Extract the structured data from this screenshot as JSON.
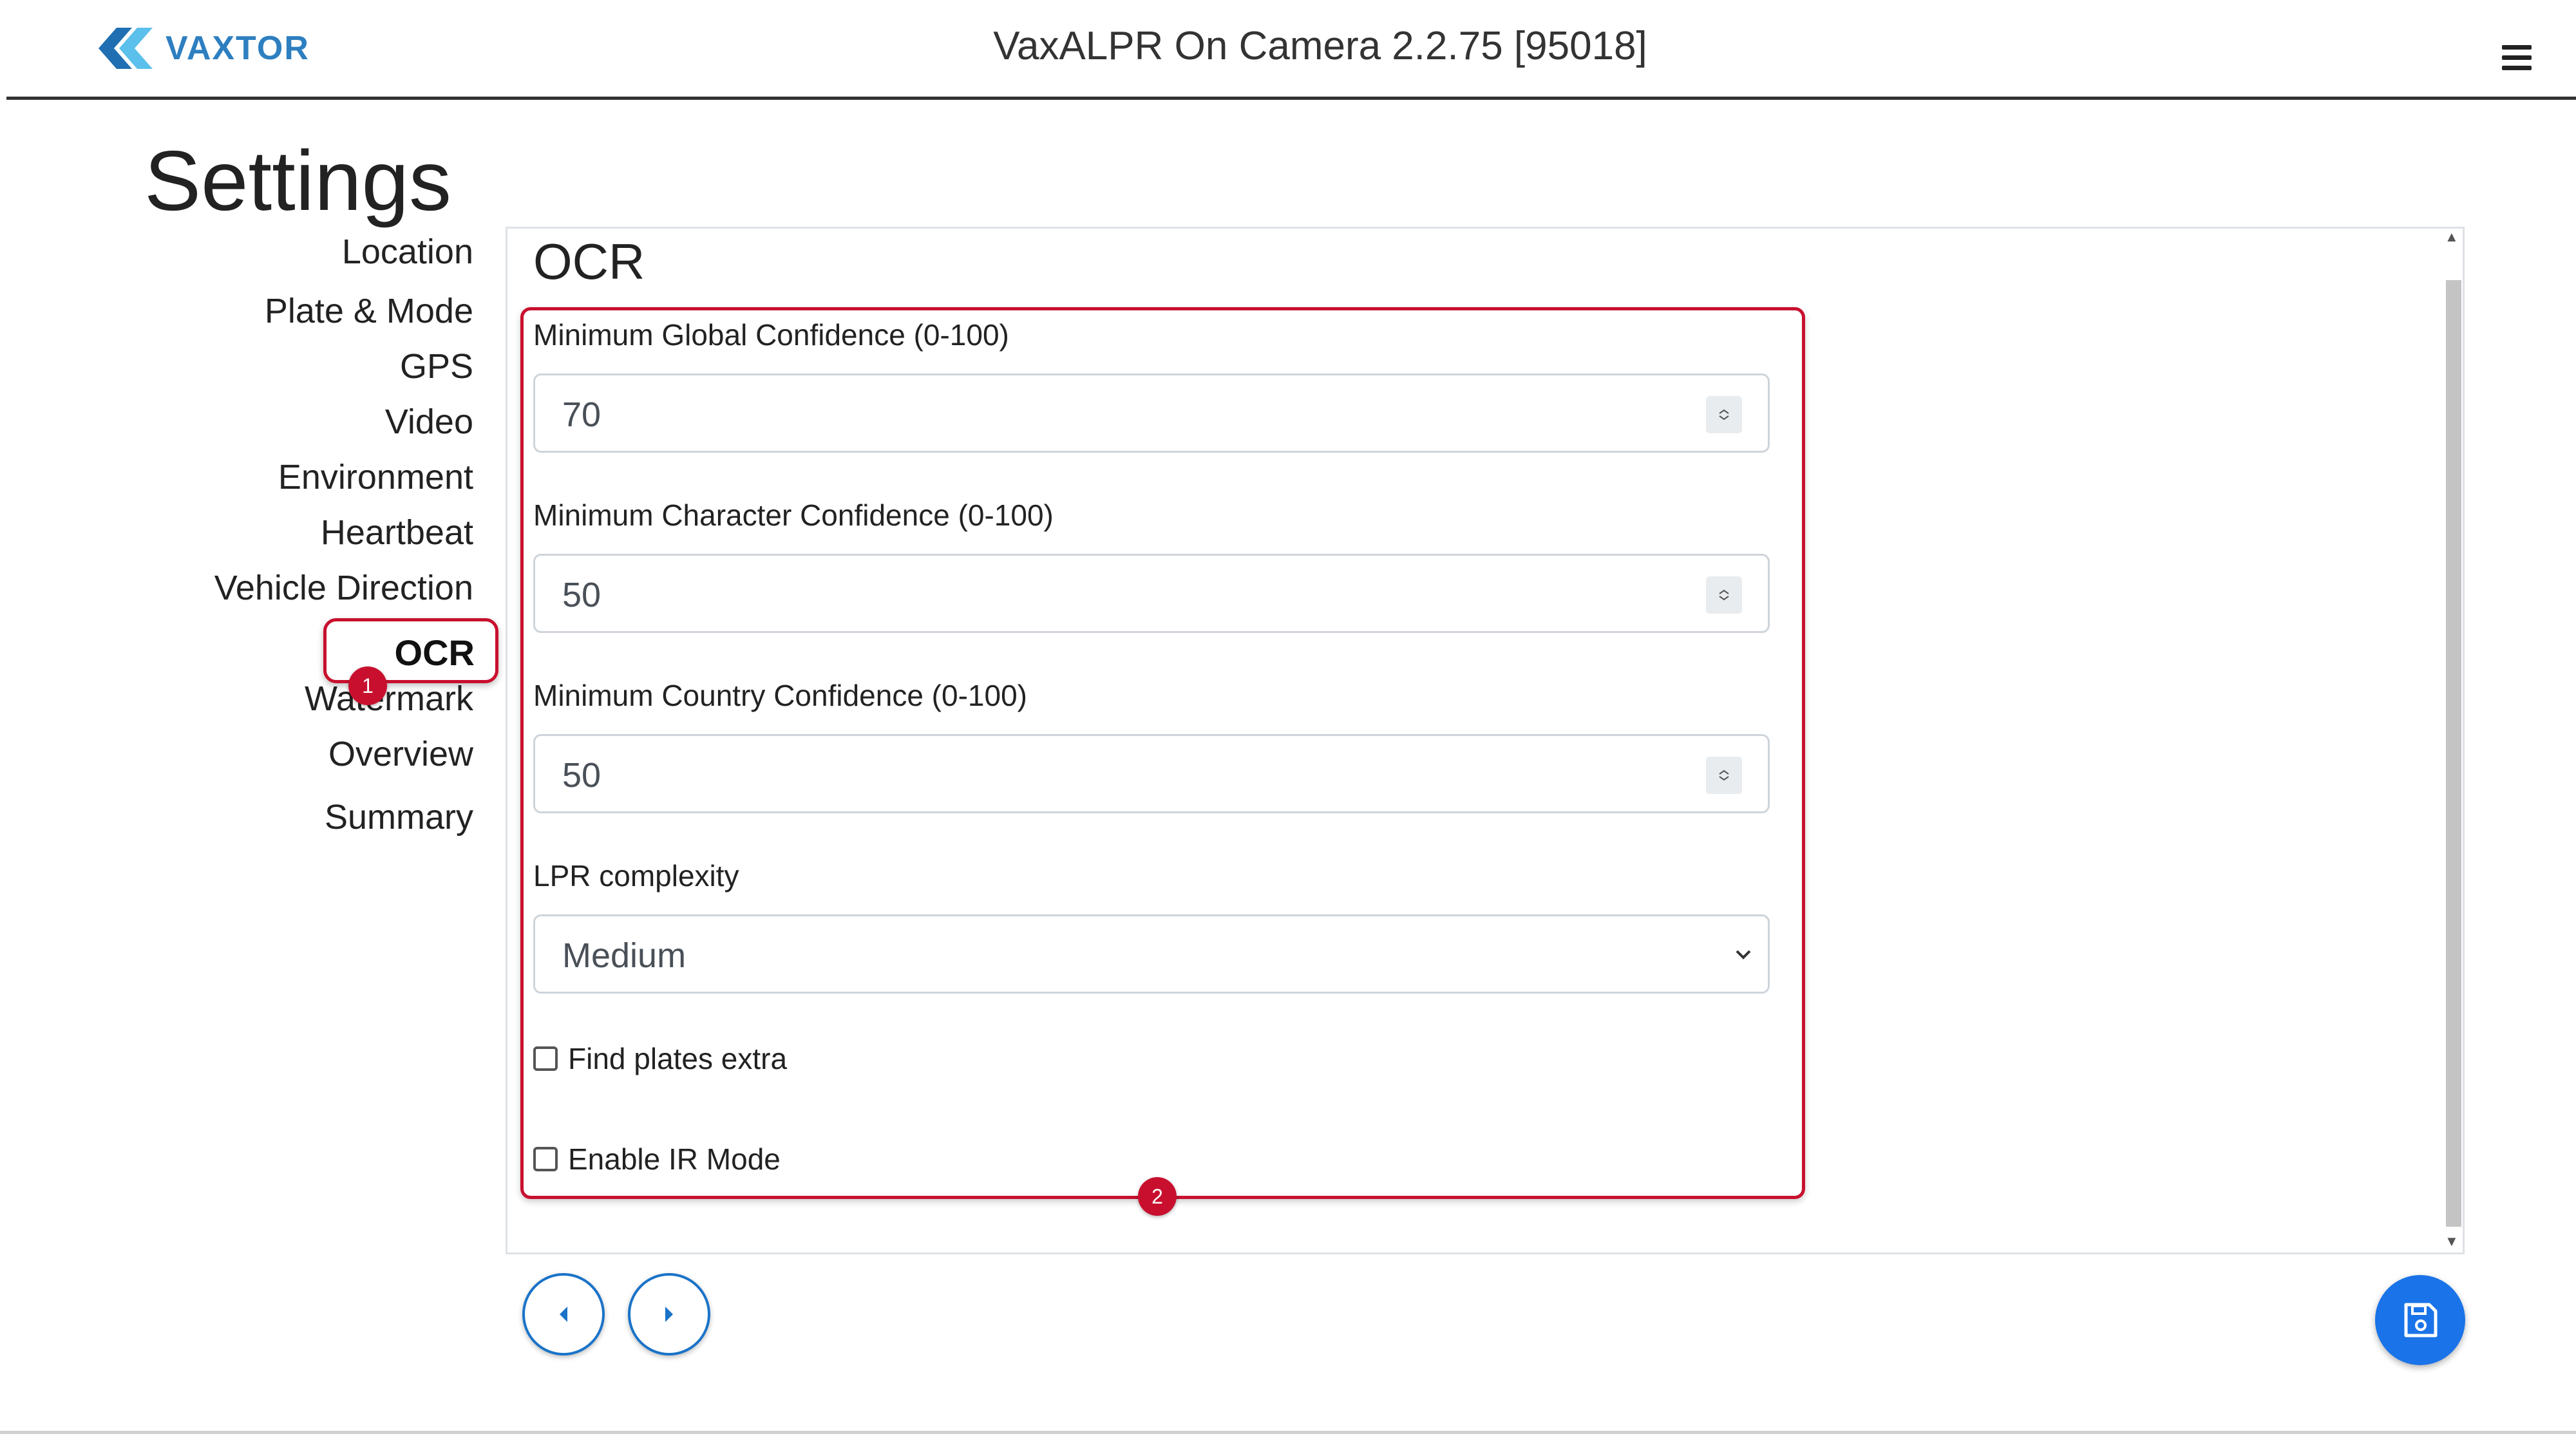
{
  "header": {
    "brand": "VAXTOR",
    "app_title": "VaxALPR On Camera  2.2.75 [95018]"
  },
  "page": {
    "title": "Settings"
  },
  "nav": {
    "items": [
      {
        "label": "Location"
      },
      {
        "label": "Plate & Mode"
      },
      {
        "label": "GPS"
      },
      {
        "label": "Video"
      },
      {
        "label": "Environment"
      },
      {
        "label": "Heartbeat"
      },
      {
        "label": "Vehicle Direction"
      },
      {
        "label": "OCR",
        "active": true
      },
      {
        "label": "Watermark"
      },
      {
        "label": "Overview"
      },
      {
        "label": "Summary"
      }
    ]
  },
  "annotations": {
    "badge1": "1",
    "badge2": "2",
    "highlight_color": "#c8102e"
  },
  "ocr": {
    "title": "OCR",
    "min_global": {
      "label": "Minimum Global Confidence (0-100)",
      "value": "70"
    },
    "min_char": {
      "label": "Minimum Character Confidence (0-100)",
      "value": "50"
    },
    "min_country": {
      "label": "Minimum Country Confidence (0-100)",
      "value": "50"
    },
    "complexity": {
      "label": "LPR complexity",
      "value": "Medium"
    },
    "find_plates_extra": {
      "label": "Find plates extra",
      "checked": false
    },
    "enable_ir": {
      "label": "Enable IR Mode",
      "checked": false
    }
  },
  "colors": {
    "accent": "#1a73e8",
    "brand": "#2d7fc0"
  }
}
